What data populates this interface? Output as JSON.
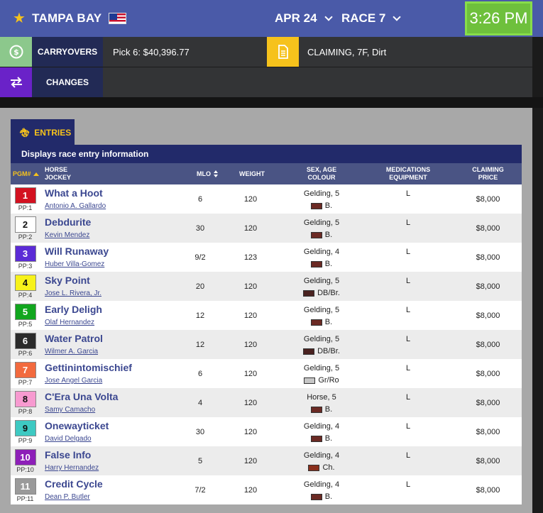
{
  "header": {
    "track": "TAMPA BAY",
    "date": "APR 24",
    "race": "RACE 7",
    "time": "3:26 PM"
  },
  "carryovers": {
    "label": "CARRYOVERS",
    "value": "Pick 6: $40,396.77"
  },
  "condition": {
    "value": "CLAIMING, 7F, Dirt"
  },
  "changes": {
    "label": "CHANGES"
  },
  "entries": {
    "tab_label": "ENTRIES",
    "description": "Displays race entry information",
    "columns": {
      "pgm": "PGM#",
      "horse": "HORSE",
      "jockey": "JOCKEY",
      "mlo": "MLO",
      "weight": "Weight",
      "sex_age": "SEX, AGE",
      "colour": "COLOUR",
      "medications": "MEDICATIONS",
      "equipment": "EQUIPMENT",
      "claiming": "CLAIMING",
      "price": "PRICE"
    },
    "rows": [
      {
        "num": "1",
        "pp": "PP:1",
        "horse": "What a Hoot",
        "jockey": "Antonio A. Gallardo",
        "mlo": "6",
        "weight": "120",
        "sex": "Gelding, 5",
        "colour": "B.",
        "med": "L",
        "price": "$8,000",
        "bg": "#d31220",
        "fg": "#ffffff",
        "sw": "#6b2a24"
      },
      {
        "num": "2",
        "pp": "PP:2",
        "horse": "Debdurite",
        "jockey": "Kevin Mendez",
        "mlo": "30",
        "weight": "120",
        "sex": "Gelding, 5",
        "colour": "B.",
        "med": "L",
        "price": "$8,000",
        "bg": "#ffffff",
        "fg": "#111111",
        "sw": "#6b2a24"
      },
      {
        "num": "3",
        "pp": "PP:3",
        "horse": "Will Runaway",
        "jockey": "Huber Villa-Gomez",
        "mlo": "9/2",
        "weight": "123",
        "sex": "Gelding, 4",
        "colour": "B.",
        "med": "L",
        "price": "$8,000",
        "bg": "#5b2bd6",
        "fg": "#ffffff",
        "sw": "#6b2a24"
      },
      {
        "num": "4",
        "pp": "PP:4",
        "horse": "Sky Point",
        "jockey": "Jose L. Rivera, Jr.",
        "mlo": "20",
        "weight": "120",
        "sex": "Gelding, 5",
        "colour": "DB/Br.",
        "med": "L",
        "price": "$8,000",
        "bg": "#f7f21a",
        "fg": "#111111",
        "sw": "#4a2220"
      },
      {
        "num": "5",
        "pp": "PP:5",
        "horse": "Early Deligh",
        "jockey": "Olaf Hernandez",
        "mlo": "12",
        "weight": "120",
        "sex": "Gelding, 5",
        "colour": "B.",
        "med": "L",
        "price": "$8,000",
        "bg": "#11a61e",
        "fg": "#ffffff",
        "sw": "#6b2a24"
      },
      {
        "num": "6",
        "pp": "PP:6",
        "horse": "Water Patrol",
        "jockey": "Wilmer A. Garcia",
        "mlo": "12",
        "weight": "120",
        "sex": "Gelding, 5",
        "colour": "DB/Br.",
        "med": "L",
        "price": "$8,000",
        "bg": "#2a2a2a",
        "fg": "#ffffff",
        "sw": "#4a2220"
      },
      {
        "num": "7",
        "pp": "PP:7",
        "horse": "Gettinintomischief",
        "jockey": "Jose Angel Garcia",
        "mlo": "6",
        "weight": "120",
        "sex": "Gelding, 5",
        "colour": "Gr/Ro",
        "med": "L",
        "price": "$8,000",
        "bg": "#f26a3e",
        "fg": "#ffffff",
        "sw": "#c6c6c6"
      },
      {
        "num": "8",
        "pp": "PP:8",
        "horse": "C'Era Una Volta",
        "jockey": "Samy Camacho",
        "mlo": "4",
        "weight": "120",
        "sex": "Horse, 5",
        "colour": "B.",
        "med": "L",
        "price": "$8,000",
        "bg": "#f79ad0",
        "fg": "#111111",
        "sw": "#6b2a24"
      },
      {
        "num": "9",
        "pp": "PP:9",
        "horse": "Onewayticket",
        "jockey": "David Delgado",
        "mlo": "30",
        "weight": "120",
        "sex": "Gelding, 4",
        "colour": "B.",
        "med": "L",
        "price": "$8,000",
        "bg": "#3ec9c2",
        "fg": "#111111",
        "sw": "#6b2a24"
      },
      {
        "num": "10",
        "pp": "PP:10",
        "horse": "False Info",
        "jockey": "Harry Hernandez",
        "mlo": "5",
        "weight": "120",
        "sex": "Gelding, 4",
        "colour": "Ch.",
        "med": "L",
        "price": "$8,000",
        "bg": "#8d1fb8",
        "fg": "#ffffff",
        "sw": "#8a2f1c"
      },
      {
        "num": "11",
        "pp": "PP:11",
        "horse": "Credit Cycle",
        "jockey": "Dean P. Butler",
        "mlo": "7/2",
        "weight": "120",
        "sex": "Gelding, 4",
        "colour": "B.",
        "med": "L",
        "price": "$8,000",
        "bg": "#9a9a9a",
        "fg": "#ffffff",
        "sw": "#6b2a24"
      }
    ]
  },
  "colors": {
    "header_blue": "#4a5aa8",
    "navy": "#222a6a",
    "accent_yellow": "#f6c21c",
    "time_green": "#6ec03c",
    "carryover_green": "#8cc88c",
    "changes_purple": "#6a22c8"
  }
}
